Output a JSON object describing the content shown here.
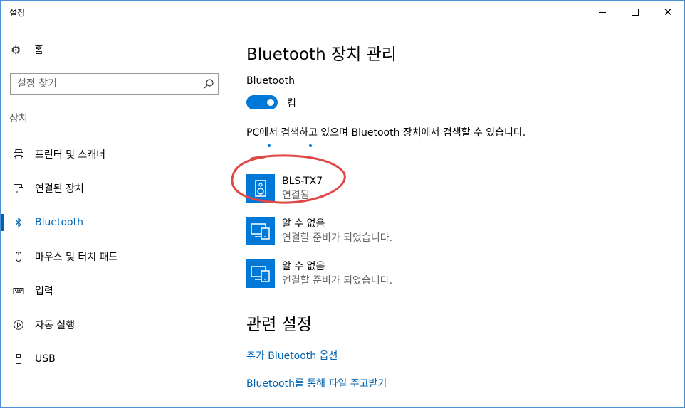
{
  "window": {
    "title": "설정"
  },
  "sidebar": {
    "home_label": "홈",
    "search_placeholder": "설정 찾기",
    "section_label": "장치",
    "items": [
      {
        "label": "프린터 및 스캐너",
        "icon": "printer-icon",
        "active": false
      },
      {
        "label": "연결된 장치",
        "icon": "connected-devices-icon",
        "active": false
      },
      {
        "label": "Bluetooth",
        "icon": "bluetooth-icon",
        "active": true
      },
      {
        "label": "마우스 및 터치 패드",
        "icon": "mouse-icon",
        "active": false
      },
      {
        "label": "입력",
        "icon": "keyboard-icon",
        "active": false
      },
      {
        "label": "자동 실행",
        "icon": "autoplay-icon",
        "active": false
      },
      {
        "label": "USB",
        "icon": "usb-icon",
        "active": false
      }
    ]
  },
  "main": {
    "title": "Bluetooth 장치 관리",
    "bluetooth_label": "Bluetooth",
    "toggle_state": "켬",
    "toggle_on": true,
    "discover_text": "PC에서 검색하고 있으며 Bluetooth 장치에서 검색할 수 있습니다.",
    "devices": [
      {
        "name": "BLS-TX7",
        "status": "연결됨",
        "icon": "speaker-icon"
      },
      {
        "name": "알 수 없음",
        "status": "연결할 준비가 되었습니다.",
        "icon": "devices-icon"
      },
      {
        "name": "알 수 없음",
        "status": "연결할 준비가 되었습니다.",
        "icon": "devices-icon"
      }
    ],
    "related_title": "관련 설정",
    "links": [
      "추가 Bluetooth 옵션",
      "Bluetooth를 통해 파일 주고받기"
    ]
  },
  "colors": {
    "accent": "#0078d7",
    "link": "#0063b1",
    "annotation": "#e04848"
  }
}
